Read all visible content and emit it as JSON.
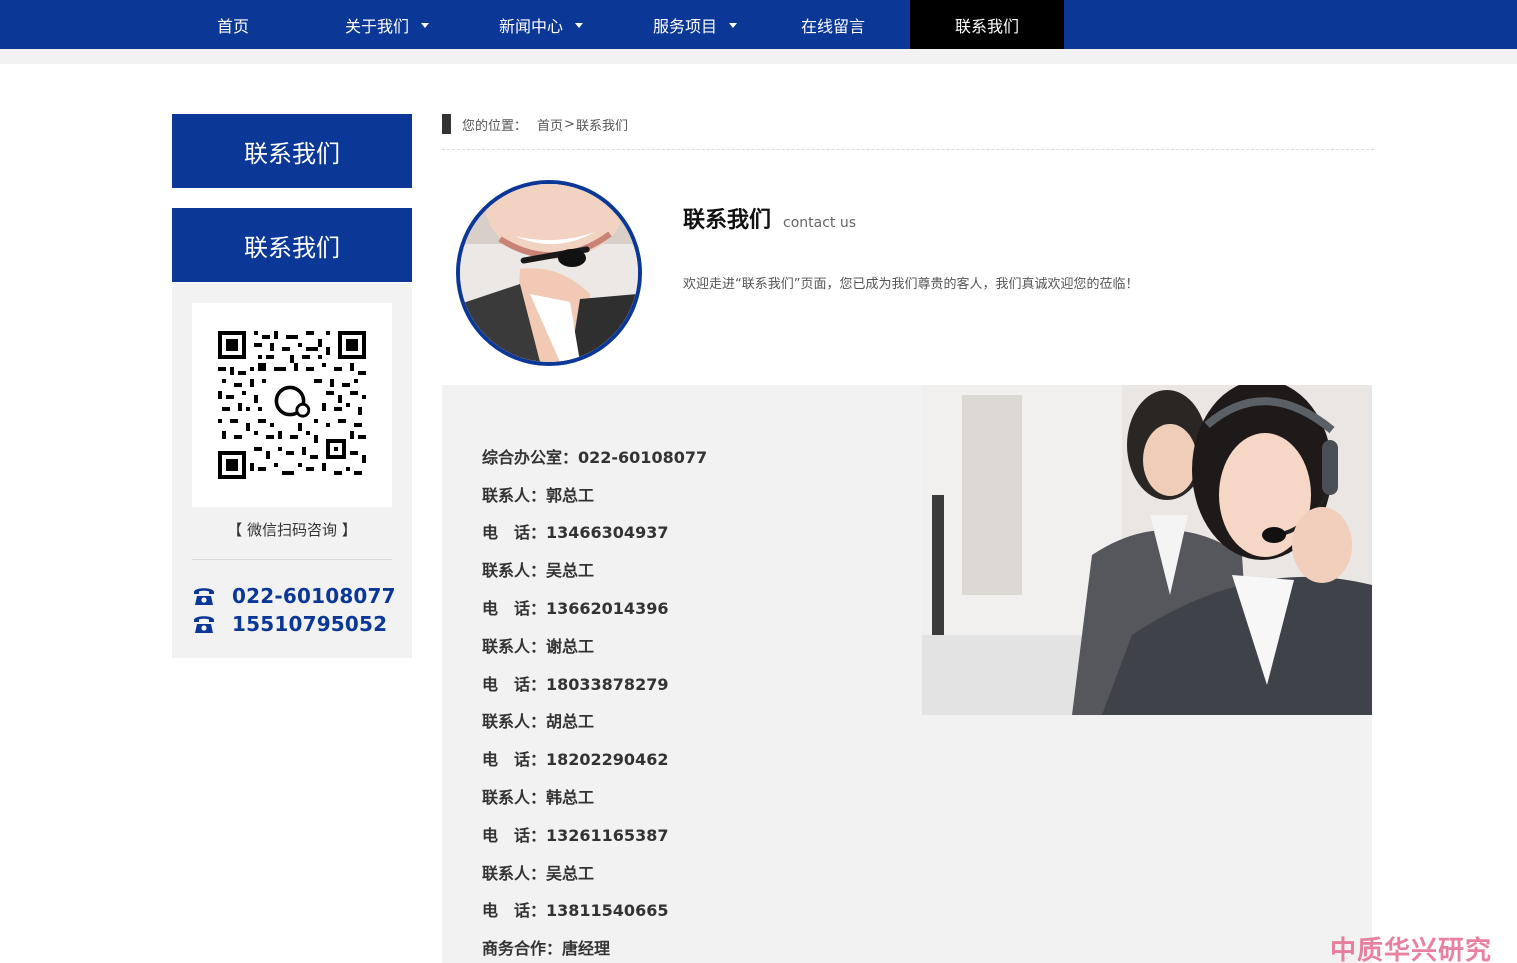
{
  "nav": {
    "items": [
      {
        "label": "首页"
      },
      {
        "label": "关于我们"
      },
      {
        "label": "新闻中心"
      },
      {
        "label": "服务项目"
      },
      {
        "label": "在线留言"
      },
      {
        "label": "联系我们"
      }
    ]
  },
  "sidebar": {
    "title_top": "联系我们",
    "title_sub": "联系我们",
    "qr_caption": "【 微信扫码咨询 】",
    "phones": [
      "022-60108077",
      "15510795052"
    ]
  },
  "breadcrumb": {
    "prefix": "您的位置：",
    "home": "首页",
    "sep": ">",
    "current": "联系我们"
  },
  "intro": {
    "title": "联系我们",
    "subtitle": "contact us",
    "text": "欢迎走进“联系我们”页面，您已成为我们尊贵的客人，我们真诚欢迎您的莅临！"
  },
  "contacts": [
    "综合办公室：022-60108077",
    "联系人：郭总工",
    "电　话：13466304937",
    "联系人：吴总工",
    "电　话：13662014396",
    "联系人：谢总工",
    "电　话：18033878279",
    "联系人：胡总工",
    "电　话：18202290462",
    "联系人：韩总工",
    "电　话：13261165387",
    "联系人：吴总工",
    "电　话：13811540665",
    "商务合作：唐经理"
  ],
  "watermark": "中质华兴研究院",
  "colors": {
    "brand_blue": "#0b3796",
    "active_nav": "#000000",
    "panel_gray": "#f2f2f2"
  }
}
